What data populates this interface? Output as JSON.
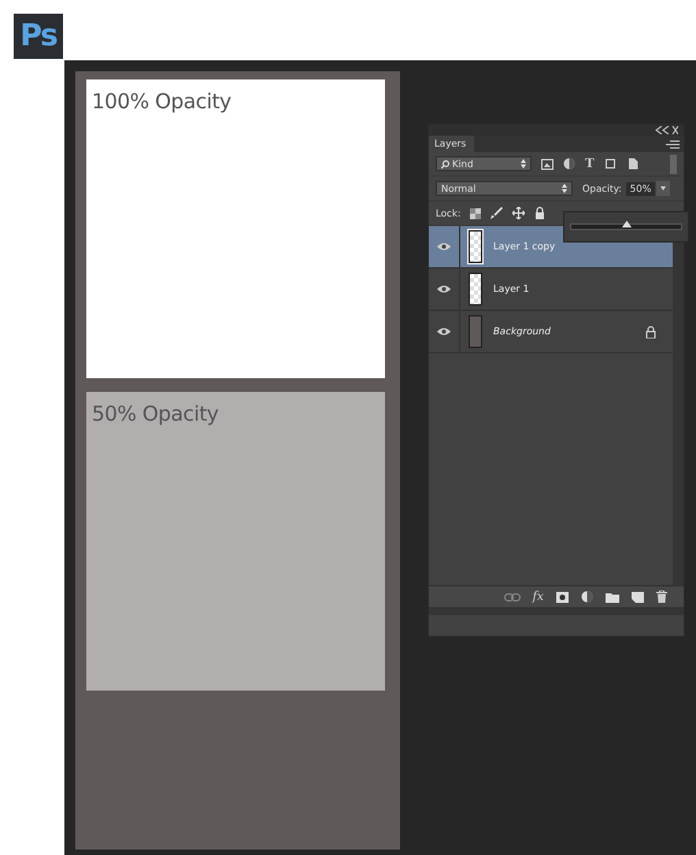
{
  "app_logo": "Ps",
  "canvas": {
    "blocks": [
      {
        "label": "100% Opacity",
        "kind": "opaque"
      },
      {
        "label": "50% Opacity",
        "kind": "half"
      }
    ]
  },
  "layers_panel": {
    "title": "Layers",
    "filter": "Kind",
    "blend_mode": "Normal",
    "opacity_label": "Opacity:",
    "opacity_value": "50%",
    "opacity_slider": {
      "level": 0.5
    },
    "lock_label": "Lock:",
    "type_filter_glyph": "T",
    "effects_glyph": "fx",
    "layers": [
      {
        "name": "Layer 1 copy",
        "selected": true,
        "visible": true,
        "locked": false,
        "kind": "transparent"
      },
      {
        "name": "Layer 1",
        "selected": false,
        "visible": true,
        "locked": false,
        "kind": "transparent"
      },
      {
        "name": "Background",
        "selected": false,
        "visible": true,
        "locked": true,
        "kind": "background"
      }
    ]
  }
}
